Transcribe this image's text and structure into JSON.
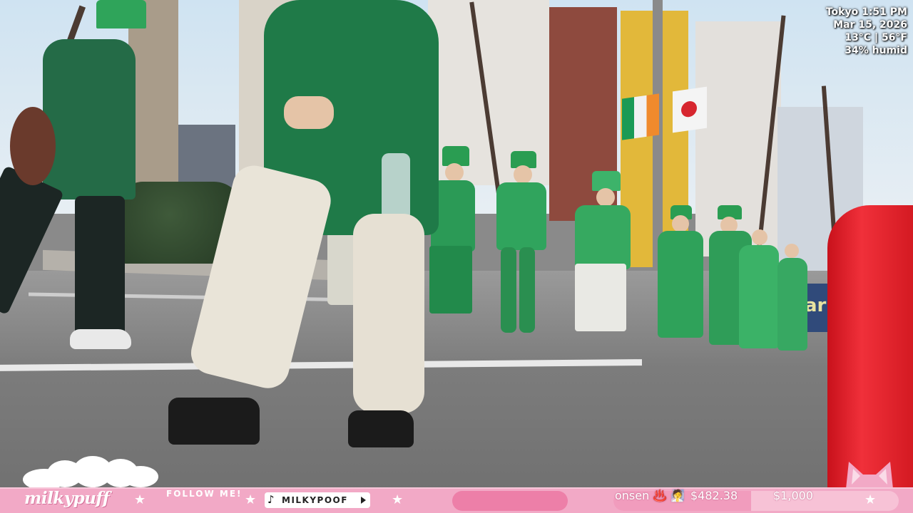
{
  "overlay": {
    "location_time": "Tokyo 1:51 PM",
    "date": "Mar 15, 2026",
    "temperature": "13°C | 56°F",
    "humidity": "34% humid"
  },
  "scene": {
    "banner_text": "arry's"
  },
  "bottom_bar": {
    "logo": "milkypuff",
    "follow_label": "FOLLOW ME!",
    "social_handle": "MILKYPOOF",
    "social_icon": "tiktok-icon",
    "star_glyph": "★",
    "goal_label": "onsen ♨️ 🧖",
    "goal_amount": "$482.38",
    "goal_target": "$1,000",
    "goal_progress": 0.48238,
    "colors": {
      "bar": "#f2a9c6",
      "pill": "#ed7fa8",
      "text": "#ffffff"
    }
  }
}
